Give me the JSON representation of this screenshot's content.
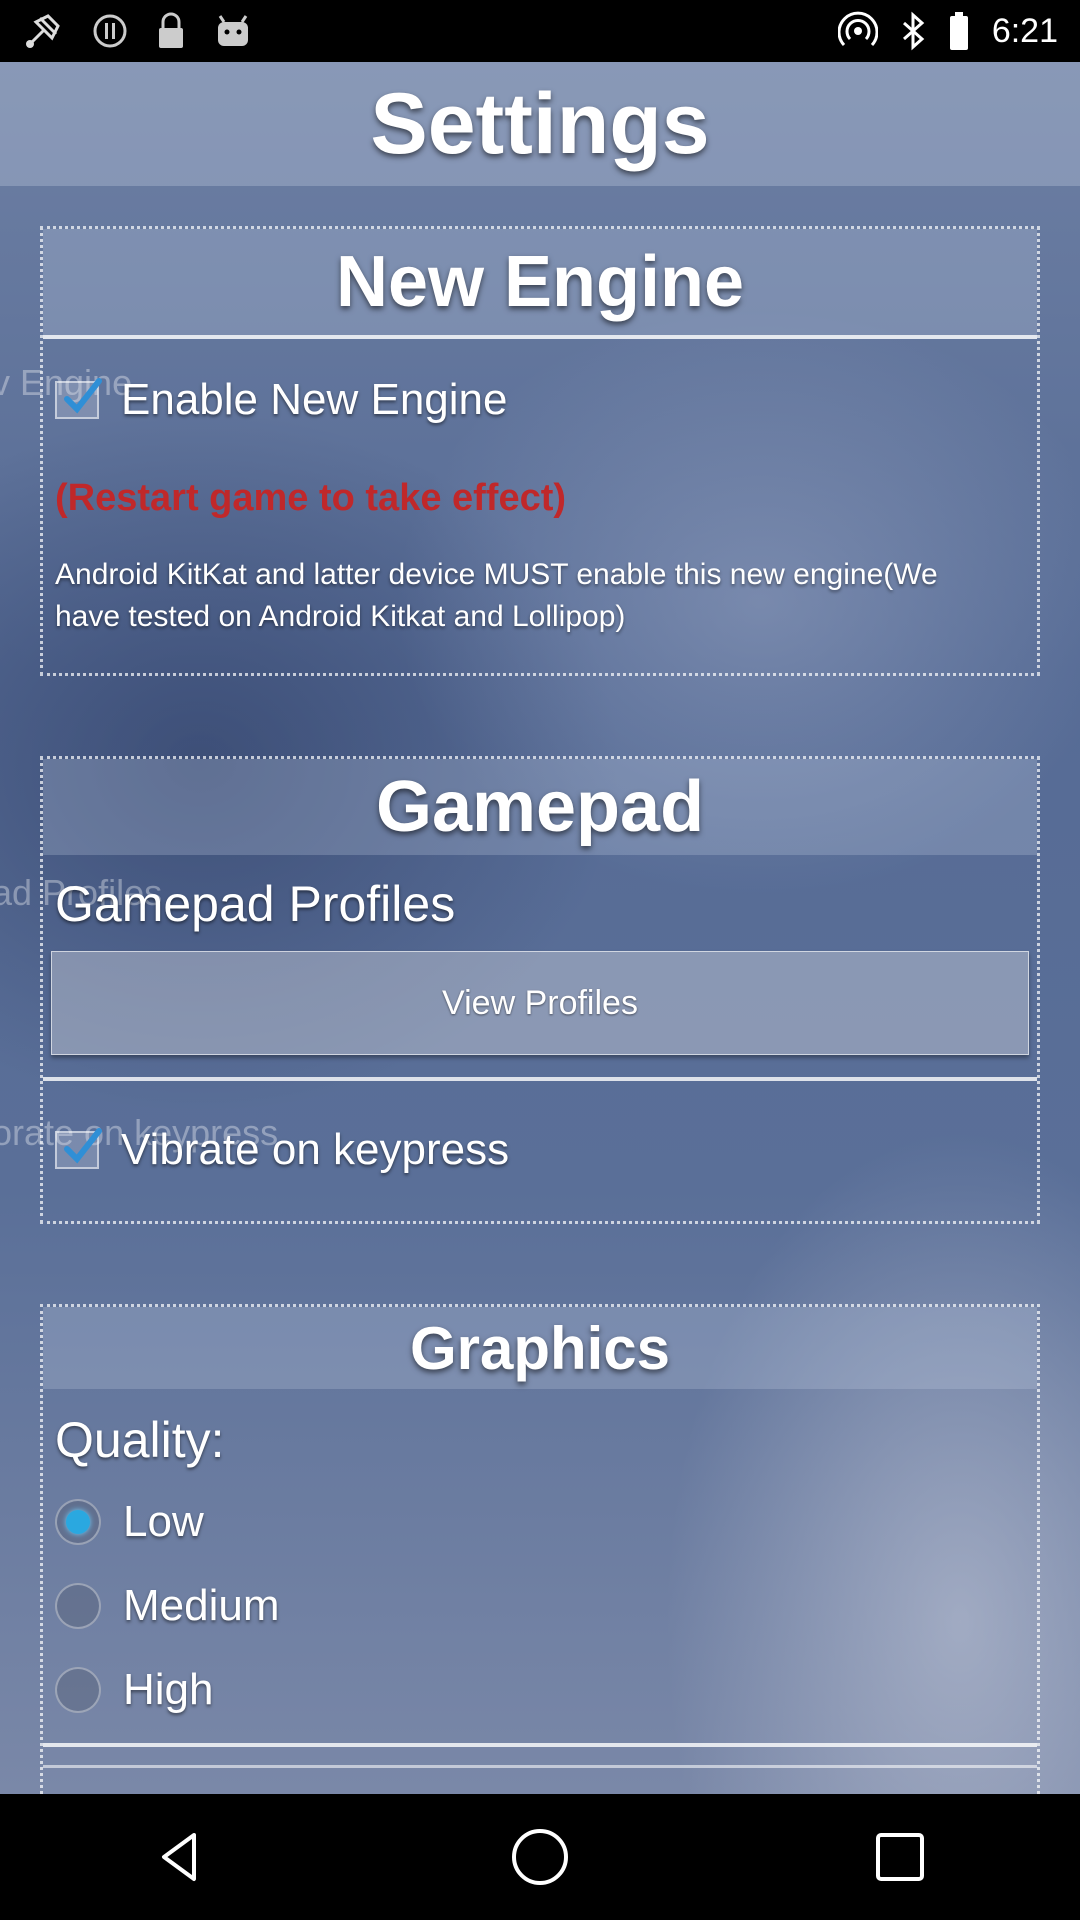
{
  "status_bar": {
    "time": "6:21",
    "left_icons": [
      "fake-gps-icon",
      "sync-icon",
      "lock-icon",
      "android-icon"
    ],
    "right_icons": [
      "hotspot-icon",
      "bluetooth-icon",
      "battery-icon"
    ]
  },
  "title": "Settings",
  "ghost_labels": {
    "new_engine": "v Engine",
    "gamepad_profiles": "ad Profiles",
    "vibrate": "orate on keypress"
  },
  "sections": {
    "new_engine": {
      "title": "New Engine",
      "enable_label": "Enable New Engine",
      "enable_checked": true,
      "restart_note": "(Restart game to take effect)",
      "description": "Android KitKat and latter device MUST enable this new engine(We have tested on Android Kitkat and Lollipop)"
    },
    "gamepad": {
      "title": "Gamepad",
      "profiles_label": "Gamepad Profiles",
      "view_profiles_button": "View Profiles",
      "vibrate_label": "Vibrate on keypress",
      "vibrate_checked": true
    },
    "graphics": {
      "title": "Graphics",
      "quality_label": "Quality:",
      "options": [
        {
          "label": "Low",
          "selected": true
        },
        {
          "label": "Medium",
          "selected": false
        },
        {
          "label": "High",
          "selected": false
        }
      ]
    }
  },
  "nav_bar": {
    "icons": [
      "back-icon",
      "home-icon",
      "recents-icon"
    ]
  },
  "colors": {
    "warning_red": "#c0282a",
    "radio_accent": "#2aa8e0",
    "check_accent": "#2f8fd6"
  }
}
